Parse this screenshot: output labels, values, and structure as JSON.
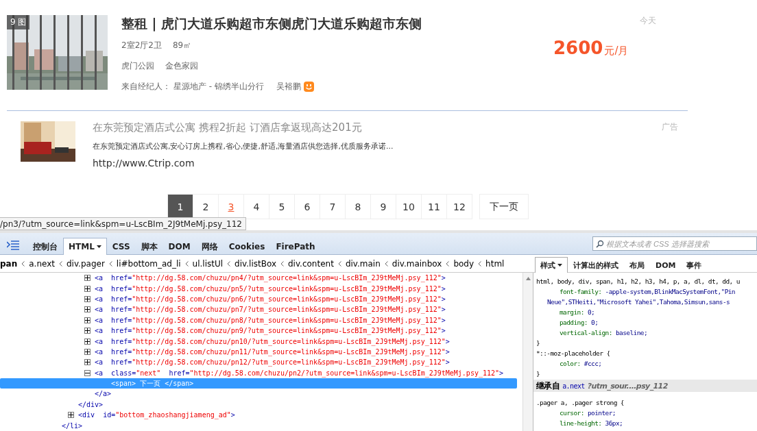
{
  "listing": {
    "photo": {
      "kind": "picture",
      "badge": "9 图"
    },
    "title": "整租 | 虎门大道乐购超市东侧虎门大道乐购超市东侧",
    "details": [
      "2室2厅2卫",
      "89㎡"
    ],
    "locations": [
      "虎门公园",
      "金色家园"
    ],
    "agent_label": "来自经纪人：",
    "agency": "星源地产 - 锦绣半山分行",
    "agent_name": "吴裕鹏",
    "date": "今天",
    "price": "2600",
    "price_unit": "元/月"
  },
  "ad": {
    "title": "在东莞预定酒店式公寓 携程2折起 订酒店拿返现高达201元",
    "description": "在东莞预定酒店式公寓,安心订房上携程,省心,便捷,舒适,海量酒店供您选择,优质服务承诺...",
    "url": "http://www.Ctrip.com",
    "label": "广告"
  },
  "pager": {
    "pages": [
      {
        "label": "1",
        "selected": true,
        "hovered": false
      },
      {
        "label": "2",
        "selected": false,
        "hovered": false
      },
      {
        "label": "3",
        "selected": false,
        "hovered": true
      },
      {
        "label": "4",
        "selected": false,
        "hovered": false
      },
      {
        "label": "5",
        "selected": false,
        "hovered": false
      },
      {
        "label": "6",
        "selected": false,
        "hovered": false
      },
      {
        "label": "7",
        "selected": false,
        "hovered": false
      },
      {
        "label": "8",
        "selected": false,
        "hovered": false
      },
      {
        "label": "9",
        "selected": false,
        "hovered": false
      },
      {
        "label": "10",
        "selected": false,
        "hovered": false
      },
      {
        "label": "11",
        "selected": false,
        "hovered": false
      },
      {
        "label": "12",
        "selected": false,
        "hovered": false
      }
    ],
    "next": "下一页"
  },
  "status_bar": {
    "url": "/pn3/?utm_source=link&spm=u-LscBIm_2J9tMeMj.psy_112"
  },
  "devtools": {
    "tabs": [
      {
        "label": "控制台",
        "selected": false,
        "menu": false
      },
      {
        "label": "HTML",
        "selected": true,
        "menu": true
      },
      {
        "label": "CSS",
        "selected": false,
        "menu": false
      },
      {
        "label": "脚本",
        "selected": false,
        "menu": false
      },
      {
        "label": "DOM",
        "selected": false,
        "menu": false
      },
      {
        "label": "网络",
        "selected": false,
        "menu": false
      },
      {
        "label": "Cookies",
        "selected": false,
        "menu": false
      },
      {
        "label": "FirePath",
        "selected": false,
        "menu": false
      }
    ],
    "search": {
      "placeholder": "根据文本或者 CSS 选择器搜索"
    },
    "breadcrumb": [
      {
        "label": "pan",
        "selected": true
      },
      {
        "label": "a.next",
        "selected": false
      },
      {
        "label": "div.pager",
        "selected": false
      },
      {
        "label": "li#bottom_ad_li",
        "selected": false
      },
      {
        "label": "ul.listUl",
        "selected": false
      },
      {
        "label": "div.listBox",
        "selected": false
      },
      {
        "label": "div.content",
        "selected": false
      },
      {
        "label": "div.main",
        "selected": false
      },
      {
        "label": "div.mainbox",
        "selected": false
      },
      {
        "label": "body",
        "selected": false
      },
      {
        "label": "html",
        "selected": false
      }
    ],
    "side_tabs": [
      {
        "label": "样式",
        "selected": true,
        "menu": true
      },
      {
        "label": "计算出的样式",
        "selected": false,
        "menu": false
      },
      {
        "label": "布局",
        "selected": false,
        "menu": false
      },
      {
        "label": "DOM",
        "selected": false,
        "menu": false
      },
      {
        "label": "事件",
        "selected": false,
        "menu": false
      }
    ],
    "html_tree": {
      "nodes": [
        {
          "close": "</li>",
          "selected": false,
          "children": [
            {
              "close": "</div>",
              "selected": false,
              "children": [
                {
                  "open": "<a",
                  "attributes": [
                    {
                      "name": "href=",
                      "value": "\"http://dg.58.com/chuzu/pn4/?utm_source=link&spm=u-LscBIm_2J9tMeMj.psy_112\""
                    }
                  ],
                  "end": ">",
                  "expanded": false,
                  "selected": false
                },
                {
                  "open": "<a",
                  "attributes": [
                    {
                      "name": "href=",
                      "value": "\"http://dg.58.com/chuzu/pn5/?utm_source=link&spm=u-LscBIm_2J9tMeMj.psy_112\""
                    }
                  ],
                  "end": ">",
                  "expanded": false,
                  "selected": false
                },
                {
                  "open": "<a",
                  "attributes": [
                    {
                      "name": "href=",
                      "value": "\"http://dg.58.com/chuzu/pn6/?utm_source=link&spm=u-LscBIm_2J9tMeMj.psy_112\""
                    }
                  ],
                  "end": ">",
                  "expanded": false,
                  "selected": false
                },
                {
                  "open": "<a",
                  "attributes": [
                    {
                      "name": "href=",
                      "value": "\"http://dg.58.com/chuzu/pn7/?utm_source=link&spm=u-LscBIm_2J9tMeMj.psy_112\""
                    }
                  ],
                  "end": ">",
                  "expanded": false,
                  "selected": false
                },
                {
                  "open": "<a",
                  "attributes": [
                    {
                      "name": "href=",
                      "value": "\"http://dg.58.com/chuzu/pn8/?utm_source=link&spm=u-LscBIm_2J9tMeMj.psy_112\""
                    }
                  ],
                  "end": ">",
                  "expanded": false,
                  "selected": false
                },
                {
                  "open": "<a",
                  "attributes": [
                    {
                      "name": "href=",
                      "value": "\"http://dg.58.com/chuzu/pn9/?utm_source=link&spm=u-LscBIm_2J9tMeMj.psy_112\""
                    }
                  ],
                  "end": ">",
                  "expanded": false,
                  "selected": false
                },
                {
                  "open": "<a",
                  "attributes": [
                    {
                      "name": "href=",
                      "value": "\"http://dg.58.com/chuzu/pn10/?utm_source=link&spm=u-LscBIm_2J9tMeMj.psy_112\""
                    }
                  ],
                  "end": ">",
                  "expanded": false,
                  "selected": false
                },
                {
                  "open": "<a",
                  "attributes": [
                    {
                      "name": "href=",
                      "value": "\"http://dg.58.com/chuzu/pn11/?utm_source=link&spm=u-LscBIm_2J9tMeMj.psy_112\""
                    }
                  ],
                  "end": ">",
                  "expanded": false,
                  "selected": false
                },
                {
                  "open": "<a",
                  "attributes": [
                    {
                      "name": "href=",
                      "value": "\"http://dg.58.com/chuzu/pn12/?utm_source=link&spm=u-LscBIm_2J9tMeMj.psy_112\""
                    }
                  ],
                  "end": ">",
                  "expanded": false,
                  "selected": false
                },
                {
                  "open": "<a",
                  "attributes": [
                    {
                      "name": "class=",
                      "value": "\"next\""
                    },
                    {
                      "name": "href=",
                      "value": "\"http://dg.58.com/chuzu/pn2/?utm_source=link&spm=u-LscBIm_2J9tMeMj.psy_112\""
                    }
                  ],
                  "end": ">",
                  "expanded": true,
                  "selected": false,
                  "close": "</a>",
                  "children": [
                    {
                      "text": "<span> 下一页 </span>",
                      "selected": true
                    }
                  ]
                }
              ]
            },
            {
              "open": "<div",
              "attributes": [
                {
                  "name": "id=",
                  "value": "\"bottom_zhaoshangjiameng_ad\""
                }
              ],
              "end": ">",
              "expanded": false,
              "selected": false
            }
          ]
        }
      ]
    },
    "styles": {
      "rules": [
        {
          "selector": "html, body, div, span, h1, h2, h3, h4, p, a, dl, dt, dd, u",
          "declarations": [
            {
              "property": "font-family:",
              "value": "-apple-system,BlinkMacSystemFont,\"Pin",
              "continuation": "Neue\",STHeiti,\"Microsoft Yahei\",Tahoma,Simsun,sans-s"
            },
            {
              "property": "margin:",
              "value": "0;"
            },
            {
              "property": "padding:",
              "value": "0;"
            },
            {
              "property": "vertical-align:",
              "value": "baseline;"
            }
          ],
          "close": "}"
        },
        {
          "selector": "*::-moz-placeholder {",
          "declarations": [
            {
              "property": "color:",
              "value": "#ccc;"
            }
          ],
          "close": "}"
        }
      ],
      "inherited": {
        "label": "继承自",
        "element": "a.next",
        "source": "?utm_sour....psy_112"
      },
      "inherited_rules": [
        {
          "selector": ".pager a, .pager strong {",
          "declarations": [
            {
              "property": "cursor:",
              "value": "pointer;"
            },
            {
              "property": "line-height:",
              "value": "36px;"
            }
          ]
        }
      ]
    }
  }
}
